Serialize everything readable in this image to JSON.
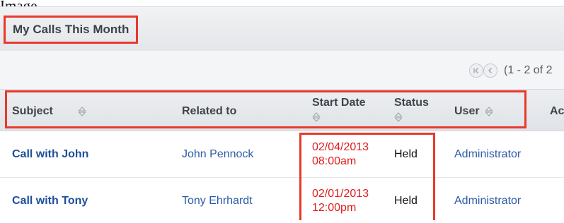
{
  "page_fragment": "Image",
  "dashlet": {
    "title": "My Calls This Month"
  },
  "pager": {
    "text": "(1 - 2 of 2"
  },
  "columns": {
    "subject": "Subject",
    "related_to": "Related to",
    "start_date": "Start Date",
    "status": "Status",
    "user": "User",
    "cut_off": "Ac"
  },
  "rows": [
    {
      "subject": "Call with John",
      "related_to": "John Pennock",
      "date": "02/04/2013",
      "time": "08:00am",
      "status": "Held",
      "user": "Administrator"
    },
    {
      "subject": "Call with Tony",
      "related_to": "Tony Ehrhardt",
      "date": "02/01/2013",
      "time": "12:00pm",
      "status": "Held",
      "user": "Administrator"
    }
  ],
  "colors": {
    "highlight": "#e8392b",
    "link": "#2d5ba8",
    "date": "#e11d1d"
  },
  "icons": [
    "first-page-icon",
    "previous-page-icon",
    "sort-icon"
  ]
}
